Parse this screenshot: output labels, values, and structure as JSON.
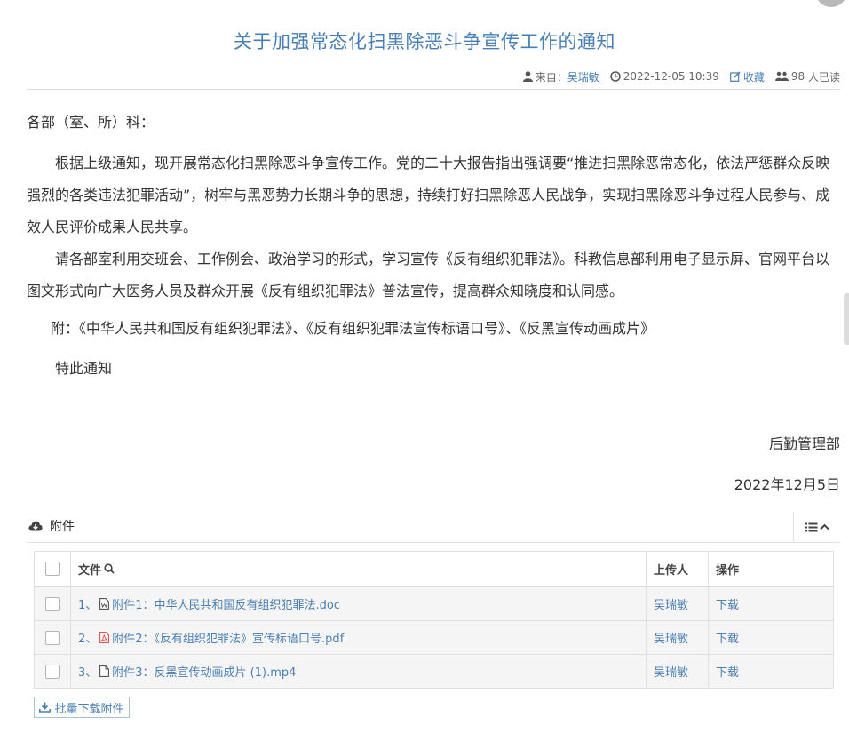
{
  "article": {
    "title": "关于加强常态化扫黑除恶斗争宣传工作的通知",
    "meta": {
      "source_label": "来自：",
      "author": "吴瑞敏",
      "datetime": "2022-12-05 10:39",
      "favorite_label": "收藏",
      "read_count": "98",
      "read_suffix": "人已读"
    },
    "salutation": "各部（室、所）科：",
    "paragraphs": [
      "根据上级通知，现开展常态化扫黑除恶斗争宣传工作。党的二十大报告指出强调要“推进扫黑除恶常态化，依法严惩群众反映强烈的各类违法犯罪活动”，树牢与黑恶势力长期斗争的思想，持续打好扫黑除恶人民战争，实现扫黑除恶斗争过程人民参与、成效人民评价成果人民共享。",
      "请各部室利用交班会、工作例会、政治学习的形式，学习宣传《反有组织犯罪法》。科教信息部利用电子显示屏、官网平台以图文形式向广大医务人员及群众开展《反有组织犯罪法》普法宣传，提高群众知晓度和认同感。"
    ],
    "appendix": "附：《中华人民共和国反有组织犯罪法》、《反有组织犯罪法宣传标语口号》、《反黑宣传动画成片》",
    "closing": "特此通知",
    "signature": "后勤管理部",
    "date": "2022年12月5日"
  },
  "attachments": {
    "section_label": "附件",
    "columns": {
      "file": "文件",
      "uploader": "上传人",
      "action": "操作"
    },
    "rows": [
      {
        "index": "1、",
        "name": "附件1：中华人民共和国反有组织犯罪法.doc",
        "icon": "word-file-icon",
        "uploader": "吴瑞敏",
        "action": "下载"
      },
      {
        "index": "2、",
        "name": "附件2：《反有组织犯罪法》宣传标语口号.pdf",
        "icon": "pdf-file-icon",
        "uploader": "吴瑞敏",
        "action": "下载"
      },
      {
        "index": "3、",
        "name": "附件3：反黑宣传动画成片 (1).mp4",
        "icon": "file-icon",
        "uploader": "吴瑞敏",
        "action": "下载"
      }
    ],
    "batch_download_label": "批量下载附件"
  },
  "colors": {
    "accent": "#4a7fb3",
    "pdf_icon": "#d9534f"
  }
}
